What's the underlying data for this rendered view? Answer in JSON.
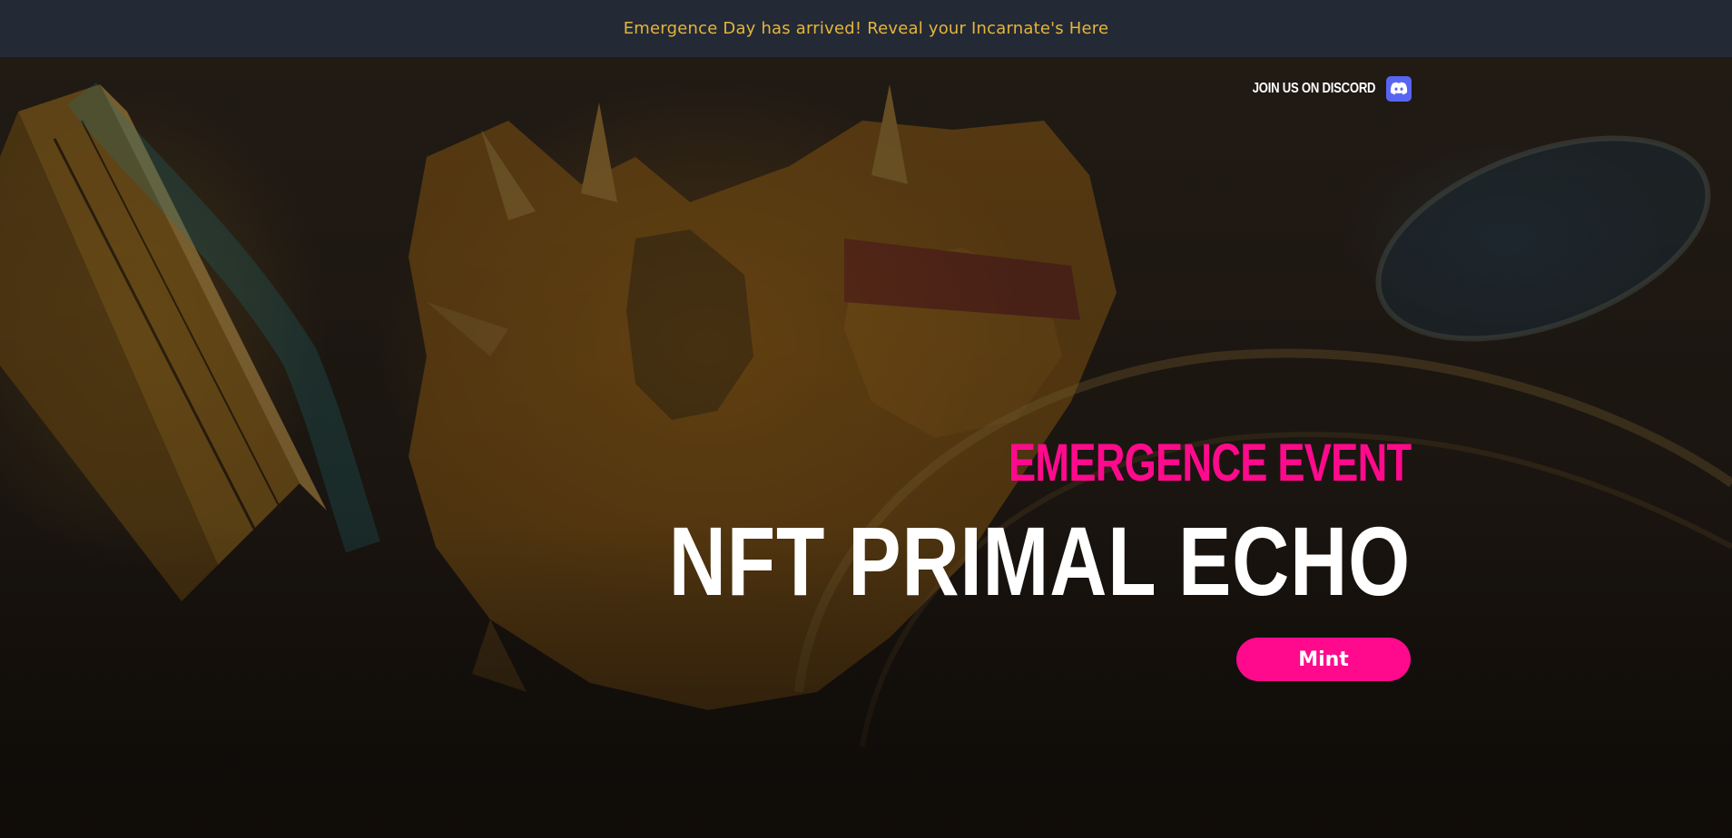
{
  "announcement": {
    "text": "Emergence Day has arrived! Reveal your Incarnate's Here"
  },
  "nav": {
    "discord_label": "JOIN US ON DISCORD",
    "discord_icon": "discord-icon"
  },
  "hero": {
    "subtitle": "EMERGENCE EVENT",
    "title": "NFT PRIMAL ECHO",
    "mint_label": "Mint"
  },
  "colors": {
    "announcement_bg": "#232a36",
    "announcement_text": "#e6b43c",
    "accent_pink": "#ff0a8c",
    "discord_blue": "#5865f2",
    "hero_bg": "#1d1712"
  }
}
